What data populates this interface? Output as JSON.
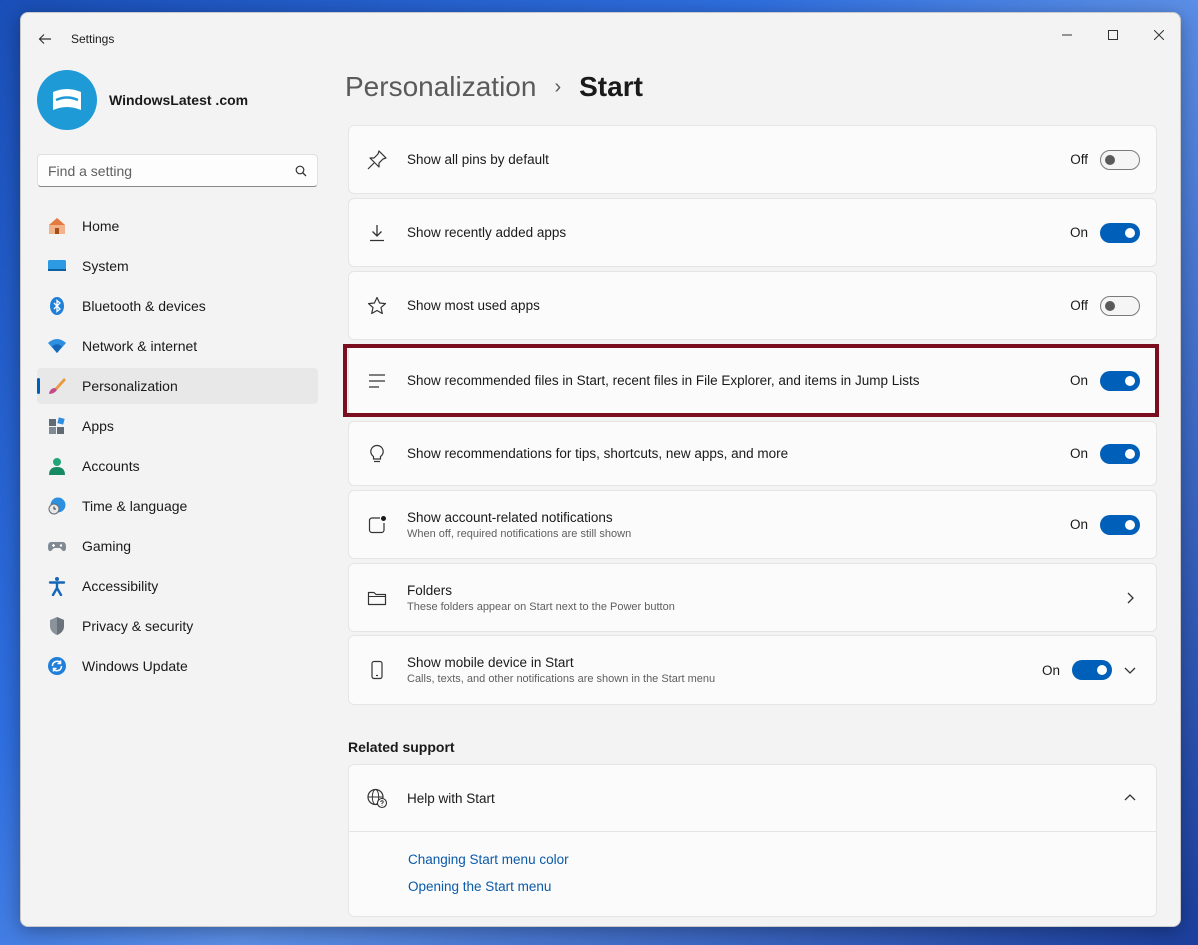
{
  "window": {
    "title": "Settings"
  },
  "profile": {
    "site_name": "WindowsLatest .com"
  },
  "search": {
    "placeholder": "Find a setting"
  },
  "nav": [
    {
      "label": "Home",
      "icon": "home-icon"
    },
    {
      "label": "System",
      "icon": "monitor-icon"
    },
    {
      "label": "Bluetooth & devices",
      "icon": "bluetooth-icon"
    },
    {
      "label": "Network & internet",
      "icon": "wifi-icon"
    },
    {
      "label": "Personalization",
      "icon": "paintbrush-icon",
      "active": true
    },
    {
      "label": "Apps",
      "icon": "apps-icon"
    },
    {
      "label": "Accounts",
      "icon": "person-icon"
    },
    {
      "label": "Time & language",
      "icon": "clock-globe-icon"
    },
    {
      "label": "Gaming",
      "icon": "gamepad-icon"
    },
    {
      "label": "Accessibility",
      "icon": "accessibility-icon"
    },
    {
      "label": "Privacy & security",
      "icon": "shield-icon"
    },
    {
      "label": "Windows Update",
      "icon": "update-icon"
    }
  ],
  "breadcrumb": {
    "parent": "Personalization",
    "separator": "›",
    "current": "Start"
  },
  "settings": [
    {
      "title": "Show all pins by default",
      "state": "Off",
      "icon": "pin-icon"
    },
    {
      "title": "Show recently added apps",
      "state": "On",
      "icon": "download-icon"
    },
    {
      "title": "Show most used apps",
      "state": "Off",
      "icon": "star-icon"
    },
    {
      "title": "Show recommended files in Start, recent files in File Explorer, and items in Jump Lists",
      "state": "On",
      "icon": "list-icon"
    },
    {
      "title": "Show recommendations for tips, shortcuts, new apps, and more",
      "state": "On",
      "icon": "lightbulb-icon"
    },
    {
      "title": "Show account-related notifications",
      "subtitle": "When off, required notifications are still shown",
      "state": "On",
      "icon": "notification-icon"
    },
    {
      "title": "Folders",
      "subtitle": "These folders appear on Start next to the Power button",
      "icon": "folder-icon"
    },
    {
      "title": "Show mobile device in Start",
      "subtitle": "Calls, texts, and other notifications are shown in the Start menu",
      "state": "On",
      "icon": "phone-icon"
    }
  ],
  "related": {
    "title": "Related support",
    "help_title": "Help with Start",
    "links": [
      "Changing Start menu color",
      "Opening the Start menu"
    ]
  },
  "colors": {
    "accent": "#005fb8",
    "highlight": "#7a0e1f",
    "link": "#0a5aa8"
  }
}
